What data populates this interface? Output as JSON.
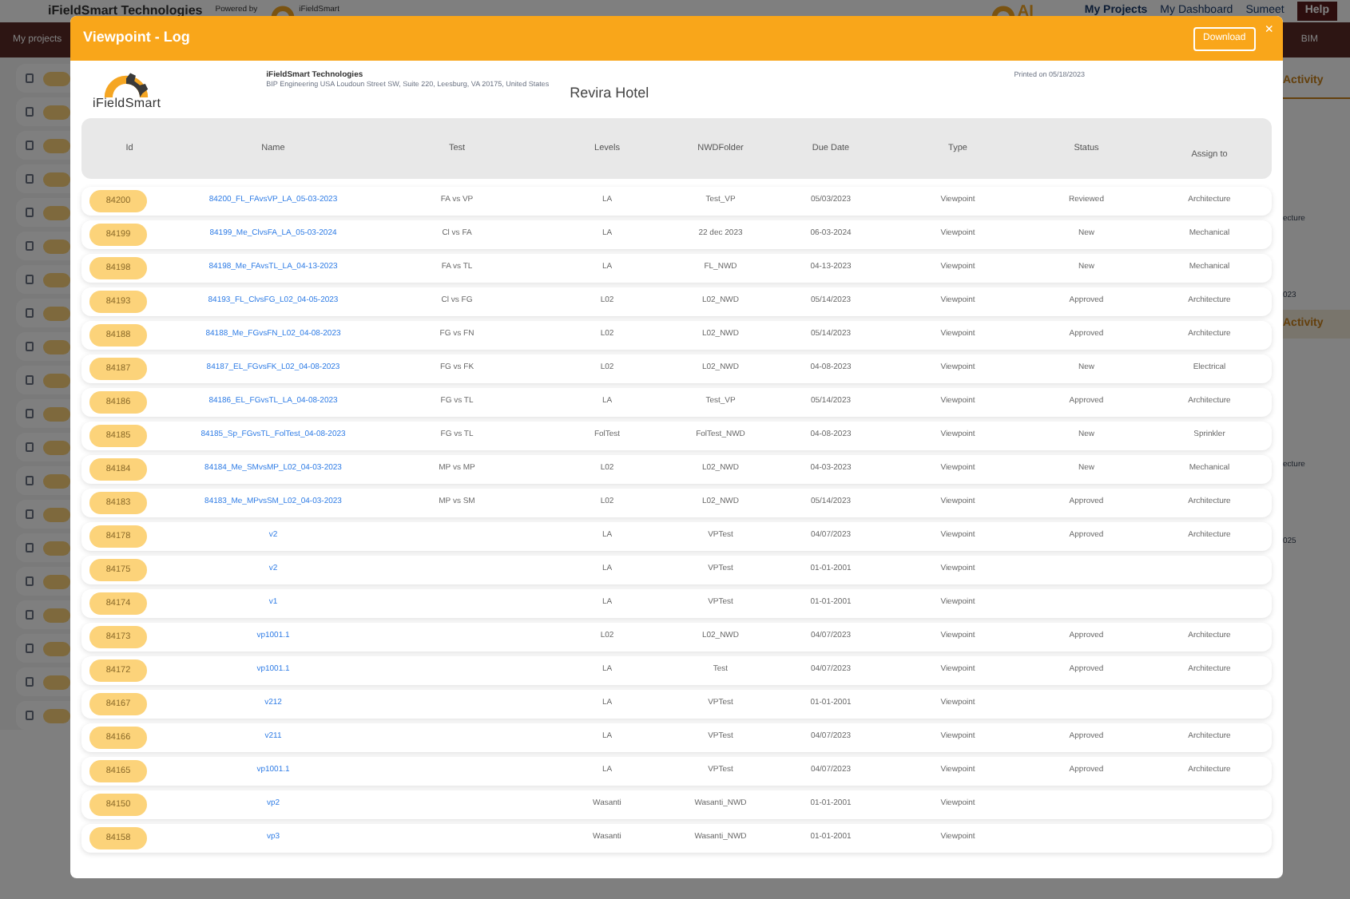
{
  "background": {
    "company": "iFieldSmart Technologies",
    "powered_by": "Powered by",
    "logo_text": "iFieldSmart",
    "ai_badge": "AI",
    "nav": [
      "My Projects",
      "My Dashboard"
    ],
    "user": "Sumeet",
    "help": "Help",
    "breadcrumb": "My projects",
    "right_tab": "BIM",
    "activity_tabs": [
      "Activity",
      "Activity"
    ],
    "right_fragments": [
      "ecture",
      "023",
      "ecture",
      "025"
    ],
    "left_rows": [
      {
        "checked": false
      },
      {
        "checked": false
      },
      {
        "checked": false
      },
      {
        "checked": false
      },
      {
        "checked": false
      },
      {
        "checked": false
      },
      {
        "checked": false
      },
      {
        "checked": false
      },
      {
        "checked": false
      },
      {
        "checked": false
      },
      {
        "checked": false
      },
      {
        "checked": false
      },
      {
        "checked": false
      },
      {
        "checked": false
      },
      {
        "checked": false
      },
      {
        "checked": false
      },
      {
        "checked": false
      },
      {
        "checked": false
      },
      {
        "checked": false
      },
      {
        "checked": false
      }
    ]
  },
  "modal": {
    "title": "Viewpoint - Log",
    "download": "Download",
    "close": "×",
    "logo_text": "iFieldSmart",
    "company": "iFieldSmart Technologies",
    "address": "BIP Engineering USA Loudoun Street SW, Suite 220, Leesburg, VA 20175, United States",
    "project": "Revira Hotel",
    "printed": "Printed on 05/18/2023",
    "columns": [
      "Id",
      "Name",
      "Test",
      "Levels",
      "NWDFolder",
      "Due Date",
      "Type",
      "Status",
      "Assign to"
    ],
    "rows": [
      [
        "84200",
        "84200_FL_FAvsVP_LA_05-03-2023",
        "FA vs VP",
        "LA",
        "Test_VP",
        "05/03/2023",
        "Viewpoint",
        "Reviewed",
        "Architecture"
      ],
      [
        "84199",
        "84199_Me_ClvsFA_LA_05-03-2024",
        "Cl vs FA",
        "LA",
        "22 dec 2023",
        "06-03-2024",
        "Viewpoint",
        "New",
        "Mechanical"
      ],
      [
        "84198",
        "84198_Me_FAvsTL_LA_04-13-2023",
        "FA vs TL",
        "LA",
        "FL_NWD",
        "04-13-2023",
        "Viewpoint",
        "New",
        "Mechanical"
      ],
      [
        "84193",
        "84193_FL_ClvsFG_L02_04-05-2023",
        "Cl vs FG",
        "L02",
        "L02_NWD",
        "05/14/2023",
        "Viewpoint",
        "Approved",
        "Architecture"
      ],
      [
        "84188",
        "84188_Me_FGvsFN_L02_04-08-2023",
        "FG vs FN",
        "L02",
        "L02_NWD",
        "05/14/2023",
        "Viewpoint",
        "Approved",
        "Architecture"
      ],
      [
        "84187",
        "84187_EL_FGvsFK_L02_04-08-2023",
        "FG vs FK",
        "L02",
        "L02_NWD",
        "04-08-2023",
        "Viewpoint",
        "New",
        "Electrical"
      ],
      [
        "84186",
        "84186_EL_FGvsTL_LA_04-08-2023",
        "FG vs TL",
        "LA",
        "Test_VP",
        "05/14/2023",
        "Viewpoint",
        "Approved",
        "Architecture"
      ],
      [
        "84185",
        "84185_Sp_FGvsTL_FolTest_04-08-2023",
        "FG vs TL",
        "FolTest",
        "FolTest_NWD",
        "04-08-2023",
        "Viewpoint",
        "New",
        "Sprinkler"
      ],
      [
        "84184",
        "84184_Me_SMvsMP_L02_04-03-2023",
        "MP vs MP",
        "L02",
        "L02_NWD",
        "04-03-2023",
        "Viewpoint",
        "New",
        "Mechanical"
      ],
      [
        "84183",
        "84183_Me_MPvsSM_L02_04-03-2023",
        "MP vs SM",
        "L02",
        "L02_NWD",
        "05/14/2023",
        "Viewpoint",
        "Approved",
        "Architecture"
      ],
      [
        "84178",
        "v2",
        "",
        "LA",
        "VPTest",
        "04/07/2023",
        "Viewpoint",
        "Approved",
        "Architecture"
      ],
      [
        "84175",
        "v2",
        "",
        "LA",
        "VPTest",
        "01-01-2001",
        "Viewpoint",
        "",
        ""
      ],
      [
        "84174",
        "v1",
        "",
        "LA",
        "VPTest",
        "01-01-2001",
        "Viewpoint",
        "",
        ""
      ],
      [
        "84173",
        "vp1001.1",
        "",
        "L02",
        "L02_NWD",
        "04/07/2023",
        "Viewpoint",
        "Approved",
        "Architecture"
      ],
      [
        "84172",
        "vp1001.1",
        "",
        "LA",
        "Test",
        "04/07/2023",
        "Viewpoint",
        "Approved",
        "Architecture"
      ],
      [
        "84167",
        "v212",
        "",
        "LA",
        "VPTest",
        "01-01-2001",
        "Viewpoint",
        "",
        ""
      ],
      [
        "84166",
        "v211",
        "",
        "LA",
        "VPTest",
        "04/07/2023",
        "Viewpoint",
        "Approved",
        "Architecture"
      ],
      [
        "84165",
        "vp1001.1",
        "",
        "LA",
        "VPTest",
        "04/07/2023",
        "Viewpoint",
        "Approved",
        "Architecture"
      ],
      [
        "84150",
        "vp2",
        "",
        "Wasanti",
        "Wasanti_NWD",
        "01-01-2001",
        "Viewpoint",
        "",
        ""
      ],
      [
        "84158",
        "vp3",
        "",
        "Wasanti",
        "Wasanti_NWD",
        "01-01-2001",
        "Viewpoint",
        "",
        ""
      ]
    ]
  }
}
